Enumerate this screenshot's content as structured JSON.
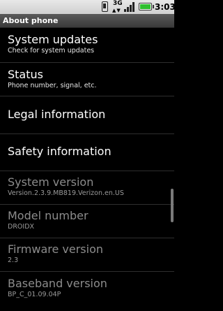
{
  "status_bar": {
    "network": "3G",
    "time": "3:03",
    "icons": [
      "phone-vibrate-icon",
      "data-arrows-icon",
      "signal-icon",
      "battery-icon"
    ],
    "battery_color": "#2fbf2f"
  },
  "header": {
    "title": "About phone"
  },
  "items": [
    {
      "title": "System updates",
      "summary": "Check for system updates"
    },
    {
      "title": "Status",
      "summary": "Phone number, signal, etc."
    },
    {
      "title": "Legal information"
    },
    {
      "title": "Safety information"
    },
    {
      "title": "System version",
      "summary": "Version.2.3.9.MB819.Verizon.en.US"
    },
    {
      "title": "Model number",
      "summary": "DROIDX"
    },
    {
      "title": "Firmware version",
      "summary": "2.3"
    },
    {
      "title": "Baseband version",
      "summary": "BP_C_01.09.04P"
    }
  ]
}
